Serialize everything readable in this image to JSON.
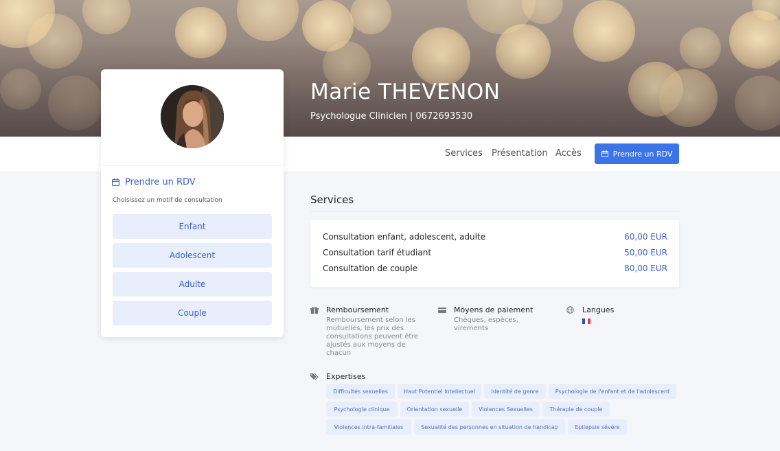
{
  "profile": {
    "name": "Marie THEVENON",
    "subtitle": "Psychologue Clinicien | 0672693530"
  },
  "nav": {
    "links": [
      "Services",
      "Présentation",
      "Accès"
    ],
    "cta_label": "Prendre un RDV"
  },
  "booking": {
    "title": "Prendre un RDV",
    "hint": "Choisissez un motif de consultation",
    "motifs": [
      "Enfant",
      "Adolescent",
      "Adulte",
      "Couple"
    ]
  },
  "services": {
    "title": "Services",
    "items": [
      {
        "name": "Consultation enfant, adolescent, adulte",
        "price": "60,00 EUR"
      },
      {
        "name": "Consultation tarif étudiant",
        "price": "50,00 EUR"
      },
      {
        "name": "Consultation de couple",
        "price": "80,00 EUR"
      }
    ]
  },
  "info": {
    "remboursement": {
      "title": "Remboursement",
      "lines": [
        "Remboursement selon les",
        "mutuelles, les prix des",
        "consultations peuvent être",
        "ajustés aux moyens de",
        "chacun"
      ]
    },
    "paiement": {
      "title": "Moyens de paiement",
      "lines": [
        "Chèques, espèces,",
        "virements"
      ]
    },
    "langues": {
      "title": "Langues",
      "flag": "french-flag"
    }
  },
  "expertises": {
    "title": "Expertises",
    "tags": [
      "Difficultés sexuelles",
      "Haut Potentiel Intellectuel",
      "Identité de genre",
      "Psychologie de l'enfant et de l'adolescent",
      "Psychologie clinique",
      "Orientation sexuelle",
      "Violences Sexuelles",
      "Thérapie de couple",
      "Violences intra-familiales",
      "Sexualité des personnes en situation de handicap",
      "Epilepsie sévère"
    ]
  },
  "colors": {
    "accent": "#3b74e6",
    "link": "#3b64c2",
    "tag_bg": "#e9eefb"
  }
}
